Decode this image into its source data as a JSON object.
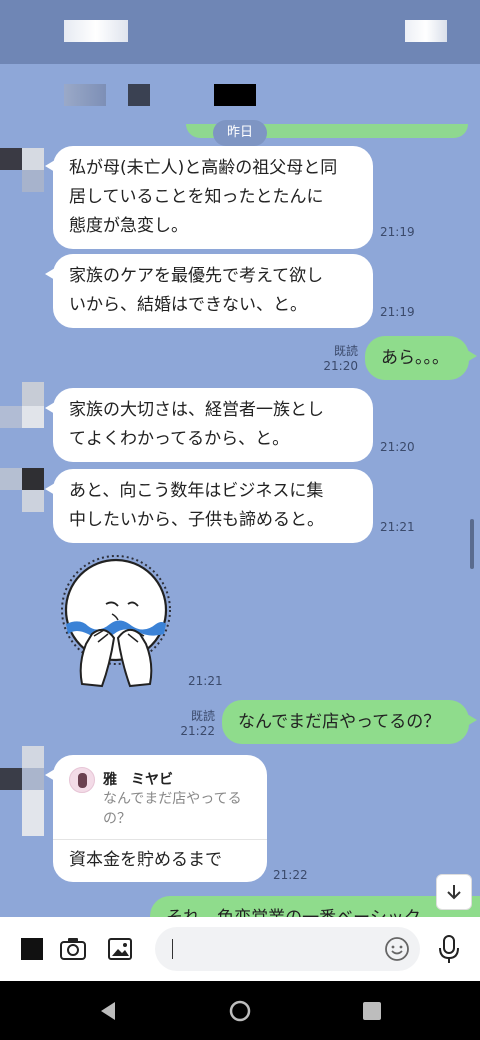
{
  "chat": {
    "date_label": "昨日",
    "messages": [
      {
        "text_lines": [
          "私が母(未亡人)と高齢の祖父母と同",
          "居していることを知ったとたんに",
          "態度が急変し。"
        ],
        "time": "21:19"
      },
      {
        "text_lines": [
          "家族のケアを最優先で考えて欲し",
          "いから、結婚はできない、と。"
        ],
        "time": "21:19"
      },
      {
        "text": "あら。。。",
        "read": "既読",
        "time": "21:20"
      },
      {
        "text_lines": [
          "家族の大切さは、経営者一族とし",
          "てよくわかってるから、と。"
        ],
        "time": "21:20"
      },
      {
        "text_lines": [
          "あと、向こう数年はビジネスに集",
          "中したいから、子供も諦めると。"
        ],
        "time": "21:21"
      },
      {
        "sticker": "crying-face-sticker",
        "time": "21:21"
      },
      {
        "text": "なんでまだ店やってるの？",
        "read": "既読",
        "time": "21:22"
      },
      {
        "reply_to_name": "雅　ミヤビ",
        "reply_to_quote_lines": [
          "なんでまだ店やってる",
          "の？"
        ],
        "text": "資本金を貯めるまで",
        "time": "21:22"
      },
      {
        "text_partial": "それ、色恋営業の一番ベーシック"
      }
    ]
  },
  "colors": {
    "background": "#8ea7d8",
    "header": "#6f86b5",
    "incoming_bubble": "#ffffff",
    "outgoing_bubble": "#8fdc8c"
  },
  "input": {
    "placeholder": "",
    "icons": [
      "stop-square-icon",
      "camera-icon",
      "image-icon",
      "emoji-icon",
      "microphone-icon"
    ]
  },
  "nav": {
    "icons": [
      "back-triangle-icon",
      "home-circle-icon",
      "recents-square-icon"
    ]
  },
  "scroll_to_bottom_icon": "arrow-down-icon"
}
